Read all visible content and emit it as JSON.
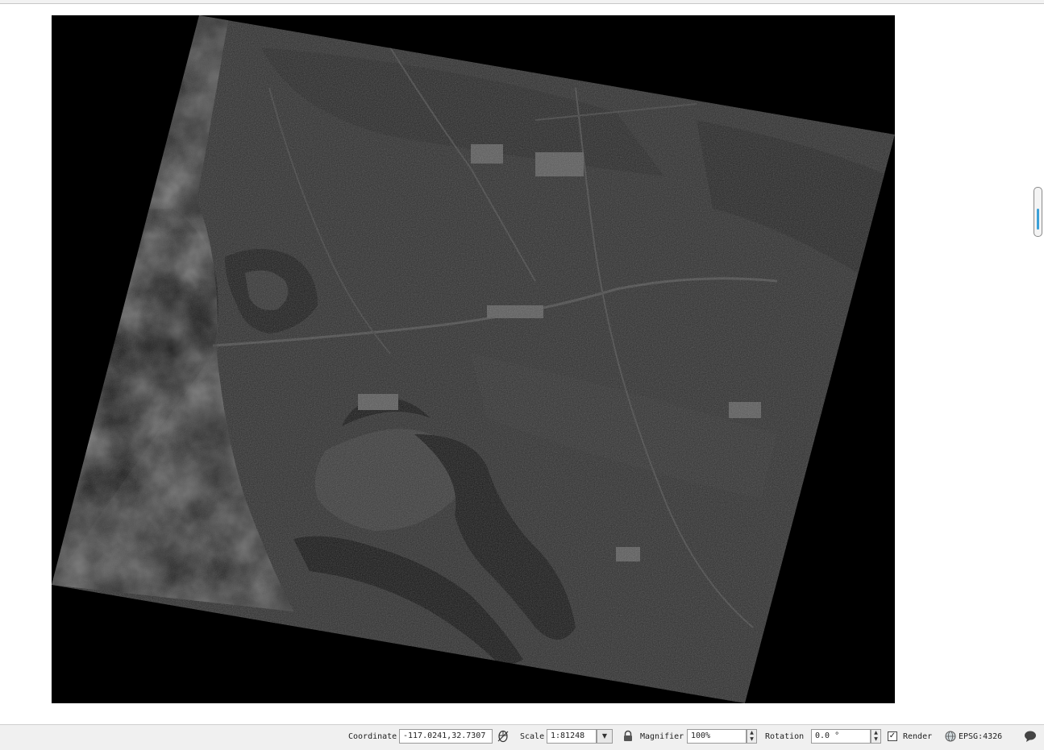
{
  "map_canvas": {
    "layer_description": "grayscale satellite raster"
  },
  "statusbar": {
    "coordinate_label": "Coordinate",
    "coordinate_value": "-117.0241,32.7307",
    "scale_label": "Scale",
    "scale_value": "1:81248",
    "magnifier_label": "Magnifier",
    "magnifier_value": "100%",
    "rotation_label": "Rotation",
    "rotation_value": "0.0 °",
    "render_label": "Render",
    "render_checked": true,
    "crs_label": "EPSG:4326",
    "icons": {
      "coordinate_toggle": "mouse-icon",
      "lock": "lock-icon",
      "crs": "globe-icon",
      "messages": "speech-bubble-icon"
    }
  },
  "colors": {
    "raster_background": "#000000",
    "statusbar_bg": "#f0f0f0",
    "accent": "#3aa0d8"
  }
}
